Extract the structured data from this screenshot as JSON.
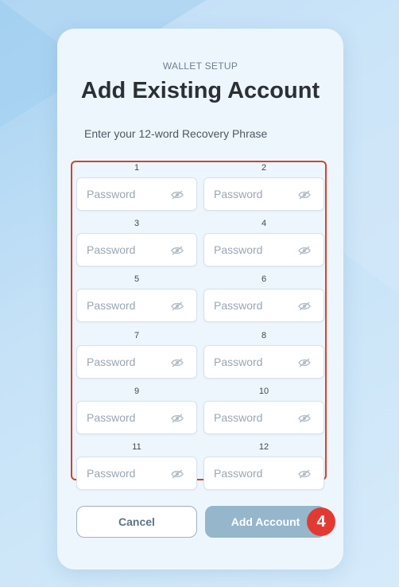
{
  "header": {
    "eyebrow": "WALLET SETUP",
    "title": "Add Existing Account",
    "subtitle": "Enter your 12-word Recovery Phrase"
  },
  "recovery_phrase": {
    "words": [
      {
        "number": "1",
        "placeholder": "Password",
        "value": ""
      },
      {
        "number": "2",
        "placeholder": "Password",
        "value": ""
      },
      {
        "number": "3",
        "placeholder": "Password",
        "value": ""
      },
      {
        "number": "4",
        "placeholder": "Password",
        "value": ""
      },
      {
        "number": "5",
        "placeholder": "Password",
        "value": ""
      },
      {
        "number": "6",
        "placeholder": "Password",
        "value": ""
      },
      {
        "number": "7",
        "placeholder": "Password",
        "value": ""
      },
      {
        "number": "8",
        "placeholder": "Password",
        "value": ""
      },
      {
        "number": "9",
        "placeholder": "Password",
        "value": ""
      },
      {
        "number": "10",
        "placeholder": "Password",
        "value": ""
      },
      {
        "number": "11",
        "placeholder": "Password",
        "value": ""
      },
      {
        "number": "12",
        "placeholder": "Password",
        "value": ""
      }
    ],
    "field_icon": "eye-slash-icon",
    "highlight_color": "#d0452c"
  },
  "actions": {
    "cancel_label": "Cancel",
    "add_label": "Add Account",
    "step_badge": "4",
    "badge_color": "#e23a32"
  }
}
